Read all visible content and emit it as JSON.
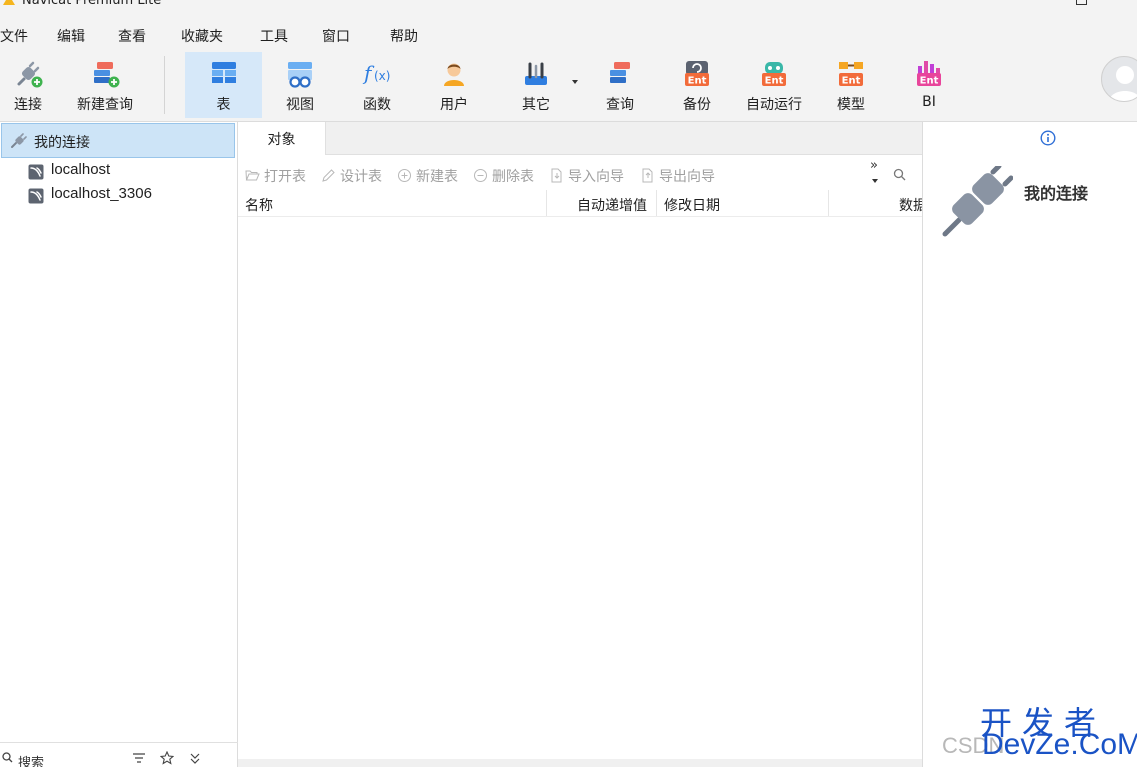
{
  "window": {
    "title": "Navicat Premium Lite"
  },
  "menu": [
    "文件",
    "编辑",
    "查看",
    "收藏夹",
    "工具",
    "窗口",
    "帮助"
  ],
  "toolbar": {
    "connect": "连接",
    "new_query": "新建查询",
    "table": "表",
    "view": "视图",
    "function": "函数",
    "user": "用户",
    "others": "其它",
    "query": "查询",
    "backup": "备份",
    "automation": "自动运行",
    "model": "模型",
    "bi": "BI",
    "ent_badge": "Ent"
  },
  "sidebar": {
    "root": "我的连接",
    "connections": [
      "localhost",
      "localhost_3306"
    ],
    "search_label": "搜索"
  },
  "main": {
    "tab": "对象",
    "actions": {
      "open_table": "打开表",
      "design_table": "设计表",
      "new_table": "新建表",
      "delete_table": "删除表",
      "import_wizard": "导入向导",
      "export_wizard": "导出向导",
      "more": "»"
    },
    "columns": {
      "name": "名称",
      "auto_increment": "自动递增值",
      "modified": "修改日期",
      "data": "数据"
    }
  },
  "info_panel": {
    "title": "我的连接"
  },
  "watermark": {
    "line1": "开发者",
    "line2": "CSDN",
    "line3": "DevZe.CoM"
  },
  "colors": {
    "selected": "#d6e8f9",
    "tree_selected": "#cde4f7",
    "disabled": "#a0a0a0",
    "accent_blue": "#1a53c5"
  }
}
